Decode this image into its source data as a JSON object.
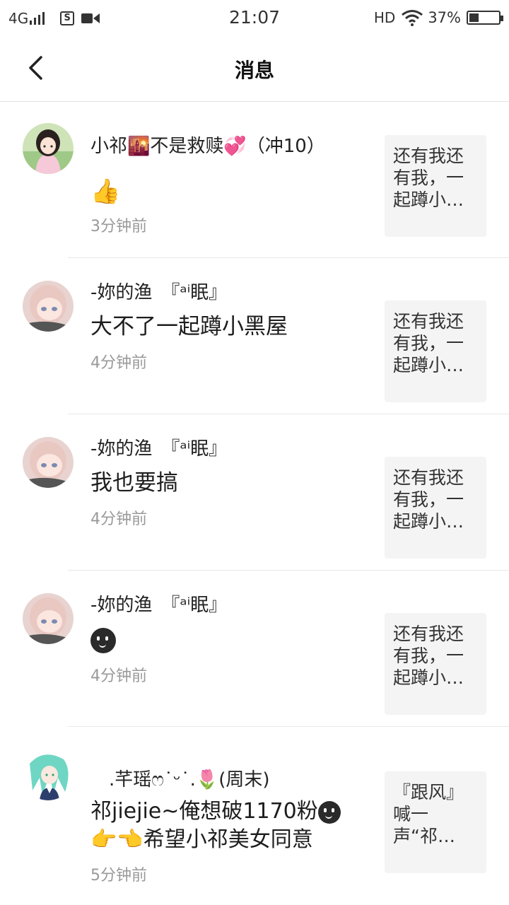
{
  "status_bar": {
    "network": "4G",
    "time": "21:07",
    "hd": "HD",
    "battery": "37%",
    "battery_level": 0.37
  },
  "header": {
    "title": "消息"
  },
  "messages": [
    {
      "name": "小祁🌇不是救赎💞（冲10）",
      "text": "👍",
      "time": "3分钟前",
      "preview": "还有我还有我，一起蹲小…"
    },
    {
      "name": "-妳的渔　『ᵃⁱ眠』",
      "text": "大不了一起蹲小黑屋",
      "time": "4分钟前",
      "preview": "还有我还有我，一起蹲小…"
    },
    {
      "name": "-妳的渔　『ᵃⁱ眠』",
      "text": "我也要搞",
      "time": "4分钟前",
      "preview": "还有我还有我，一起蹲小…"
    },
    {
      "name": "-妳的渔　『ᵃⁱ眠』",
      "text": "",
      "time": "4分钟前",
      "preview": "还有我还有我，一起蹲小…"
    },
    {
      "name": "　.芊瑶ෆ˙ᵕ˙.🌷(周末)",
      "text_line1": "祁jiejie~俺想破1170粉",
      "text_line2": "👉👈希望小祁美女同意",
      "time": "5分钟前",
      "preview": "『跟风』喊一声“祁…"
    }
  ]
}
